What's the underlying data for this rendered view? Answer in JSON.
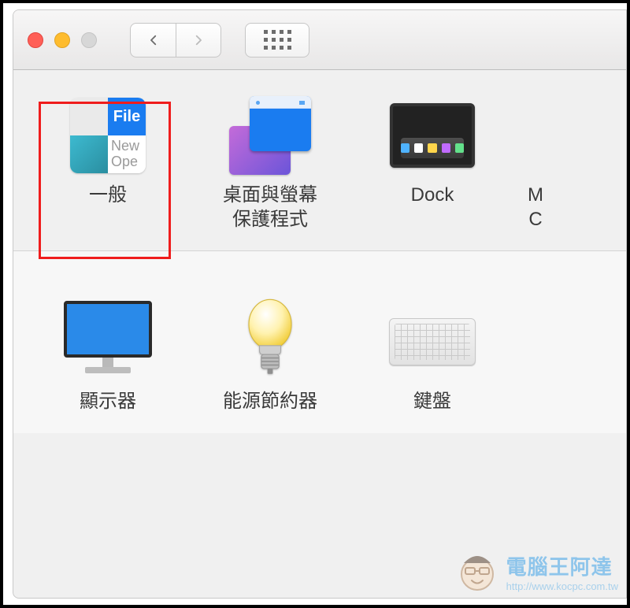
{
  "toolbar": {
    "back": "‹",
    "forward": "›"
  },
  "row1": {
    "general": {
      "label": "一般",
      "icon_file_word": "File",
      "icon_line1": "New",
      "icon_line2": "Ope"
    },
    "desktop": {
      "label": "桌面與螢幕\n保護程式"
    },
    "dock": {
      "label": "Dock"
    },
    "mission": {
      "label_l1": "M",
      "label_l2": "C"
    }
  },
  "row2": {
    "displays": {
      "label": "顯示器"
    },
    "energy": {
      "label": "能源節約器"
    },
    "keyboard": {
      "label": "鍵盤"
    }
  },
  "watermark": {
    "main": "電腦王阿達",
    "sub": "http://www.kocpc.com.tw"
  }
}
